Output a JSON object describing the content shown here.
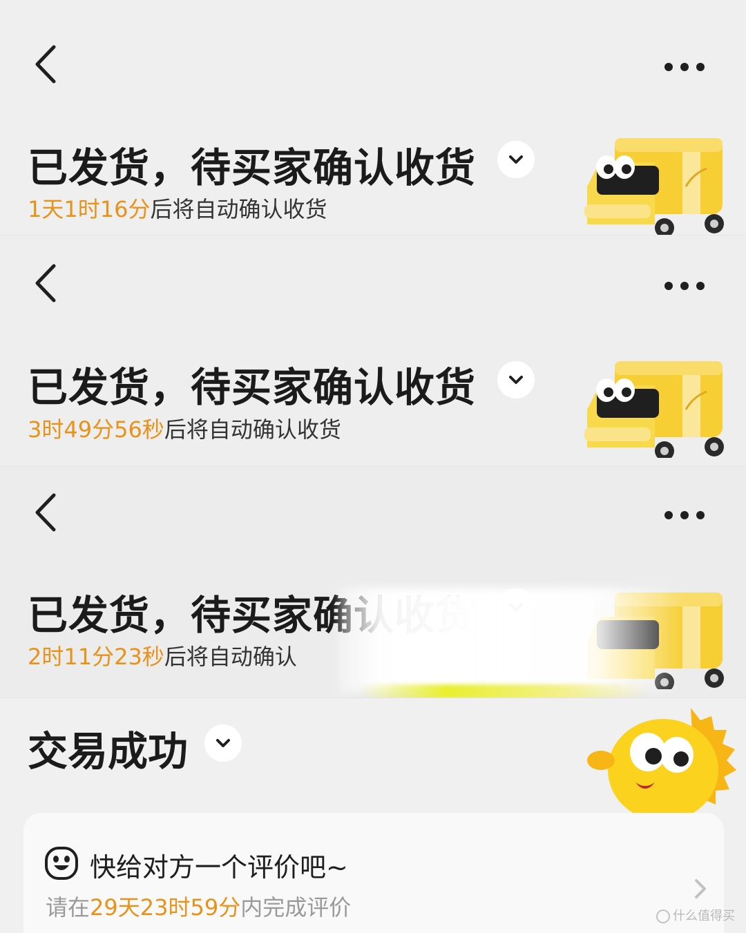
{
  "panels": [
    {
      "status_title": "已发货，待买家确认收货",
      "countdown_time": "1天1时16分",
      "countdown_suffix": "后将自动确认收货"
    },
    {
      "status_title": "已发货，待买家确认收货",
      "countdown_time": "3时49分56秒",
      "countdown_suffix": "后将自动确认收货"
    },
    {
      "status_title": "已发货，待买家确认收货",
      "countdown_time": "2时11分23秒",
      "countdown_suffix": "后将自动确认"
    }
  ],
  "success": {
    "title": "交易成功",
    "review_title": "快给对方一个评价吧~",
    "review_prefix": "请在",
    "review_days": "29天",
    "review_hours": "23时",
    "review_minutes": "59分",
    "review_suffix": "内完成评价"
  },
  "watermark": {
    "text": "什么值得买"
  },
  "icons": {
    "back": "back-arrow-icon",
    "more": "more-dots-icon",
    "chevron": "chevron-down-icon",
    "truck": "delivery-truck-icon",
    "mascot": "fish-mascot-icon",
    "smiley": "smiley-face-icon",
    "arrow": "chevron-right-icon"
  },
  "colors": {
    "accent_orange": "#e8921a",
    "truck_yellow": "#f7cf35",
    "text_dark": "#1b1b1b",
    "text_gray": "#9a9a9a"
  }
}
